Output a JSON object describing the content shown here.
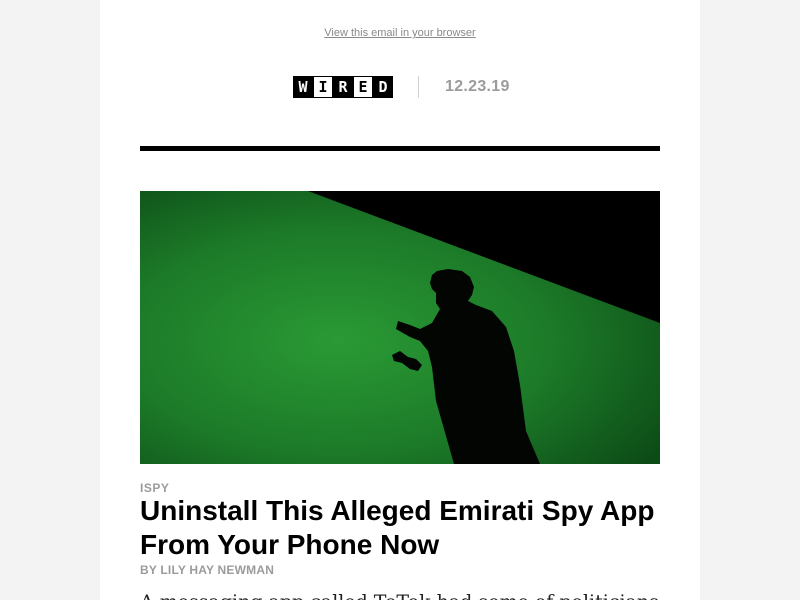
{
  "email": {
    "view_in_browser": "View this email in your browser",
    "masthead": {
      "logo_letters": [
        "W",
        "I",
        "R",
        "E",
        "D"
      ],
      "date": "12.23.19"
    },
    "story": {
      "kicker": "ISPY",
      "headline": "Uninstall This Alleged Emirati Spy App From Your Phone Now",
      "byline": "BY LILY HAY NEWMAN",
      "dek": "A messaging app called ToTok had some of politicians"
    }
  },
  "colors": {
    "page_background": "#f3f3f3",
    "email_background": "#ffffff",
    "rule": "#000000",
    "muted_text": "#9b9b9b",
    "hero_green": "#1e8a2e",
    "hero_black": "#000000"
  }
}
